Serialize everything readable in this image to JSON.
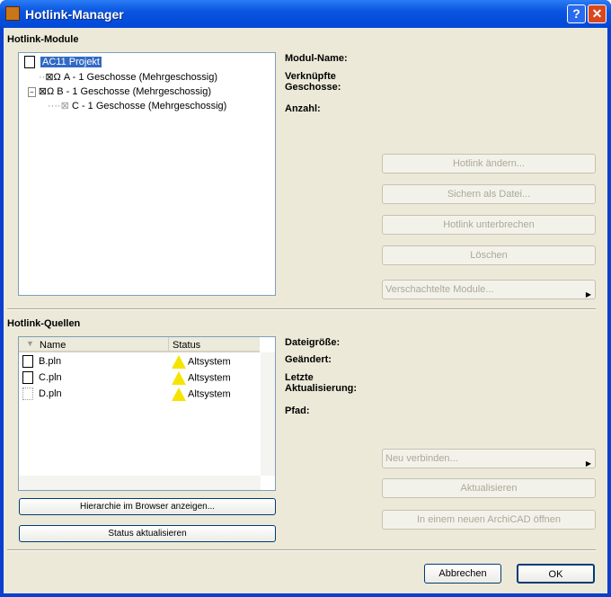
{
  "window": {
    "title": "Hotlink-Manager",
    "help": "?",
    "close": "✕"
  },
  "modules": {
    "heading": "Hotlink-Module",
    "tree": [
      {
        "label": "AC11 Projekt"
      },
      {
        "label": "A - 1 Geschosse (Mehrgeschossig)"
      },
      {
        "label": "B - 1 Geschosse (Mehrgeschossig)"
      },
      {
        "label": "C - 1 Geschosse (Mehrgeschossig)"
      }
    ],
    "info": {
      "name": "Modul-Name:",
      "stories": "Verknüpfte Geschosse:",
      "count": "Anzahl:"
    },
    "buttons": {
      "change": "Hotlink ändern...",
      "save": "Sichern als Datei...",
      "break": "Hotlink unterbrechen",
      "delete": "Löschen",
      "nested": "Verschachtelte Module..."
    }
  },
  "sources": {
    "heading": "Hotlink-Quellen",
    "columns": {
      "name": "Name",
      "status": "Status"
    },
    "rows": [
      {
        "name": "B.pln",
        "status": "Altsystem"
      },
      {
        "name": "C.pln",
        "status": "Altsystem"
      },
      {
        "name": "D.pln",
        "status": "Altsystem"
      }
    ],
    "info": {
      "size": "Dateigröße:",
      "modified": "Geändert:",
      "updated": "Letzte Aktualisierung:",
      "path": "Pfad:"
    },
    "buttons": {
      "show": "Hierarchie im Browser anzeigen...",
      "refresh_status": "Status aktualisieren",
      "relink": "Neu verbinden...",
      "update": "Aktualisieren",
      "open": "In einem neuen ArchiCAD öffnen"
    }
  },
  "footer": {
    "cancel": "Abbrechen",
    "ok": "OK"
  }
}
